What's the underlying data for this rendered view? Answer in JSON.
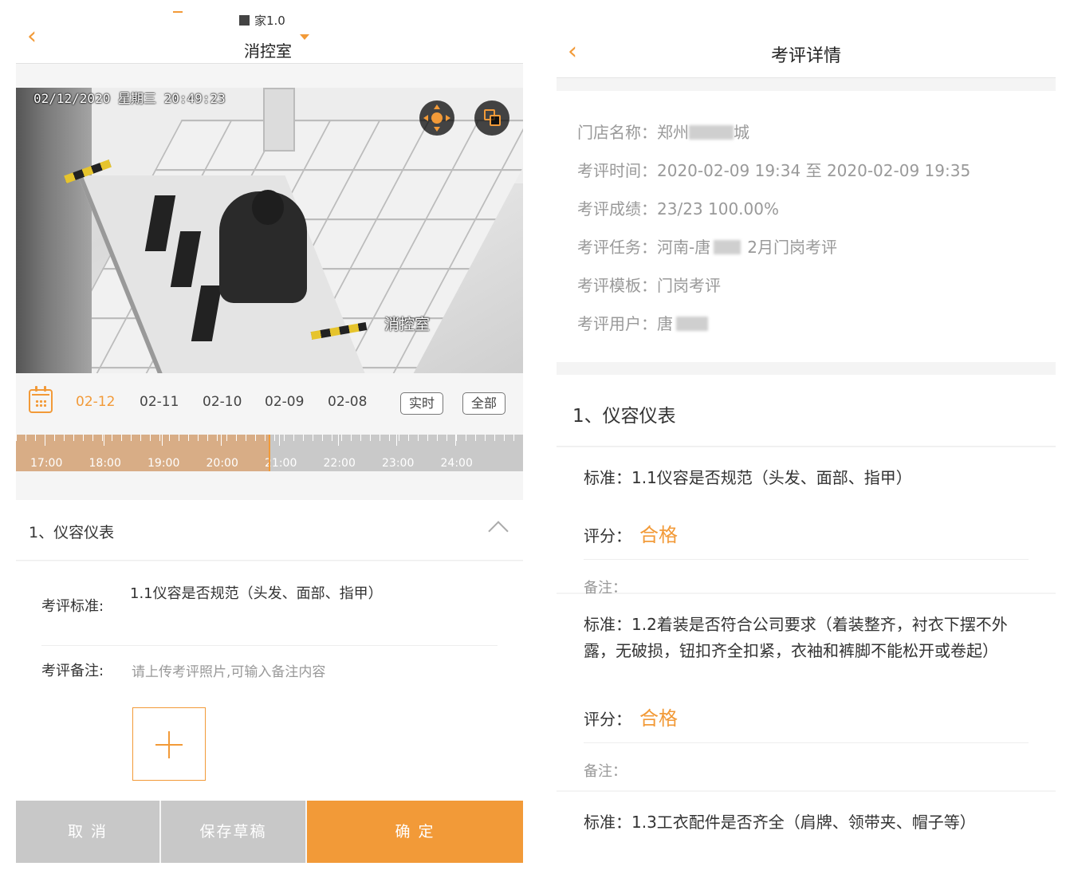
{
  "left": {
    "device_name": "家1.0",
    "title": "消控室",
    "video": {
      "timestamp": "02/12/2020  星期三  20:49:23",
      "camera_label": "消控室",
      "ptz_icon": "ptz-direction-icon",
      "snapshot_icon": "snapshot-icon"
    },
    "dates": [
      "02-12",
      "02-11",
      "02-10",
      "02-09",
      "02-08"
    ],
    "selected_date": "02-12",
    "realtime_label": "实时",
    "all_label": "全部",
    "timeline": {
      "labels": [
        "17:00",
        "18:00",
        "19:00",
        "20:00",
        "21:00",
        "22:00",
        "23:00",
        "24:00"
      ],
      "current_time": "20:49",
      "colors": {
        "played": "#d8ad86",
        "remaining": "#c9c9c9",
        "cursor": "#f29a38"
      }
    },
    "section_title": "1、仪容仪表",
    "form": {
      "standard_label": "考评标准:",
      "standard_value": "1.1仪容是否规范（头发、面部、指甲）",
      "note_label": "考评备注:",
      "note_placeholder": "请上传考评照片,可输入备注内容",
      "upload_icon": "plus-icon"
    },
    "actions": {
      "cancel": "取 消",
      "draft": "保存草稿",
      "confirm": "确 定"
    }
  },
  "right": {
    "title": "考评详情",
    "info": [
      {
        "label": "门店名称：",
        "value": "郑州",
        "suffix": "城",
        "blurred": true
      },
      {
        "label": "考评时间：",
        "value": "2020-02-09 19:34 至 2020-02-09 19:35"
      },
      {
        "label": "考评成绩：",
        "value": "23/23 100.00%"
      },
      {
        "label": "考评任务：",
        "value": "河南-唐",
        "suffix": "2月门岗考评",
        "blurred": true
      },
      {
        "label": "考评模板：",
        "value": "门岗考评"
      },
      {
        "label": "考评用户：",
        "value": "唐",
        "blurred": true
      }
    ],
    "section_title": "1、仪容仪表",
    "criteria": [
      {
        "standard_label": "标准：",
        "standard": "1.1仪容是否规范（头发、面部、指甲）",
        "score_label": "评分：",
        "score": "合格",
        "note_label": "备注："
      },
      {
        "standard_label": "标准：",
        "standard": "1.2着装是否符合公司要求（着装整齐，衬衣下摆不外露，无破损，钮扣齐全扣紧，衣袖和裤脚不能松开或卷起）",
        "score_label": "评分：",
        "score": "合格",
        "note_label": "备注："
      },
      {
        "standard_label": "标准：",
        "standard": "1.3工衣配件是否齐全（肩牌、领带夹、帽子等）"
      }
    ],
    "accent_color": "#f29a38"
  }
}
